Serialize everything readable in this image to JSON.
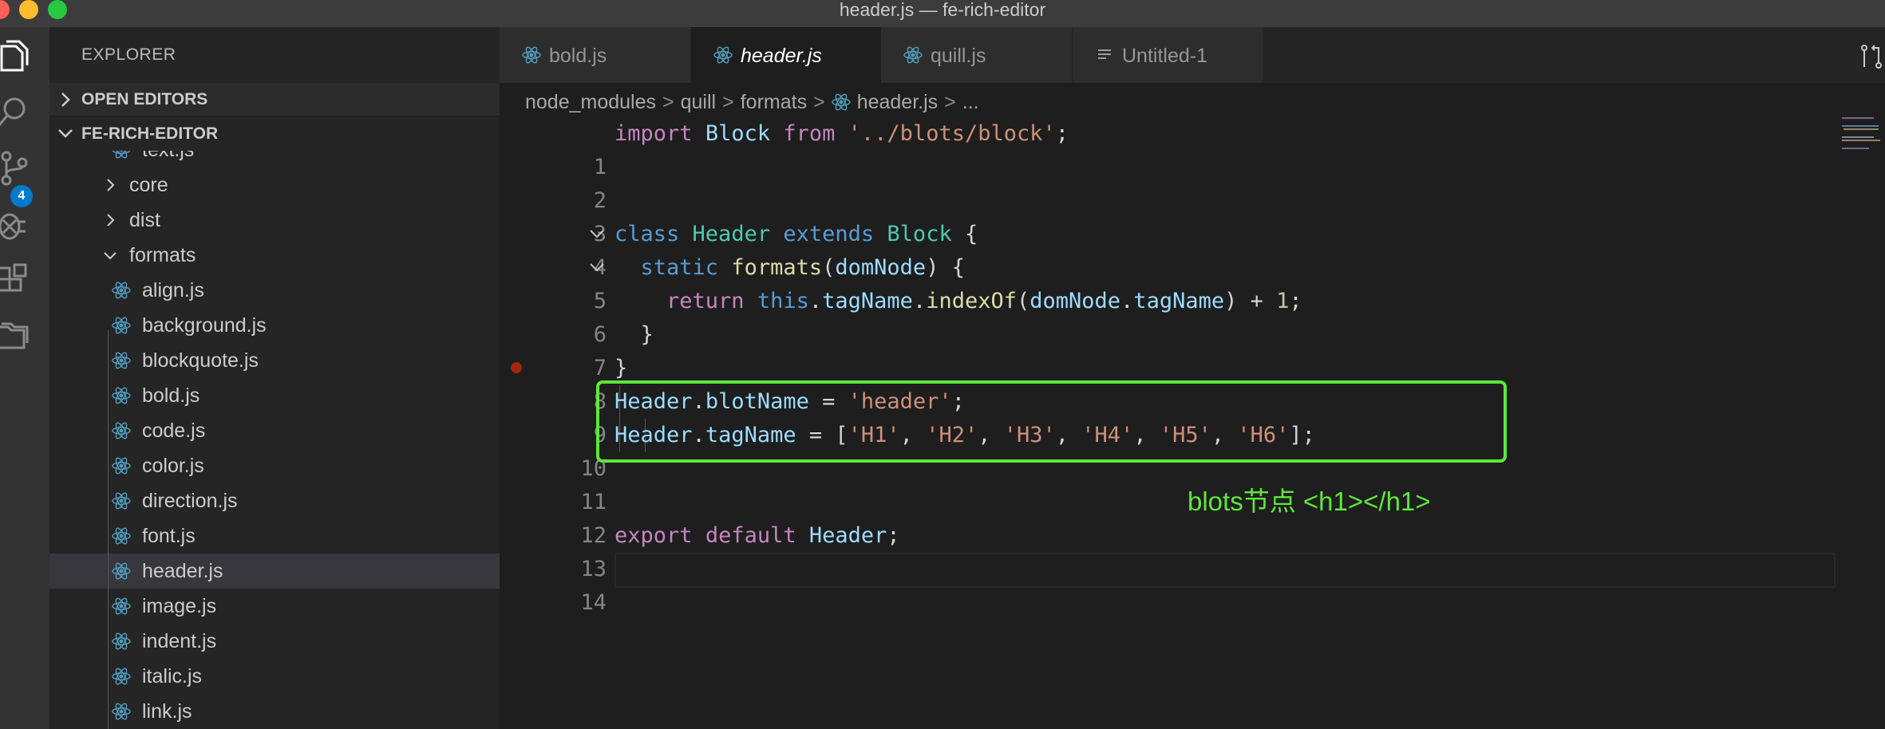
{
  "window": {
    "title": "header.js — fe-rich-editor"
  },
  "activity_bar": {
    "items": [
      {
        "icon": "files-icon"
      },
      {
        "icon": "search-icon"
      },
      {
        "icon": "source-control-icon",
        "badge": "4"
      },
      {
        "icon": "debug-icon"
      },
      {
        "icon": "extensions-icon"
      },
      {
        "icon": "folder-icon"
      }
    ]
  },
  "sidebar": {
    "title": "EXPLORER",
    "open_editors": "OPEN EDITORS",
    "project": "FE-RICH-EDITOR",
    "tree": [
      {
        "name": "text.js",
        "type": "file"
      },
      {
        "name": "core",
        "type": "folder"
      },
      {
        "name": "dist",
        "type": "folder"
      },
      {
        "name": "formats",
        "type": "folder-open"
      },
      {
        "name": "align.js",
        "type": "file"
      },
      {
        "name": "background.js",
        "type": "file"
      },
      {
        "name": "blockquote.js",
        "type": "file"
      },
      {
        "name": "bold.js",
        "type": "file"
      },
      {
        "name": "code.js",
        "type": "file"
      },
      {
        "name": "color.js",
        "type": "file"
      },
      {
        "name": "direction.js",
        "type": "file"
      },
      {
        "name": "font.js",
        "type": "file"
      },
      {
        "name": "header.js",
        "type": "file",
        "selected": true
      },
      {
        "name": "image.js",
        "type": "file"
      },
      {
        "name": "indent.js",
        "type": "file"
      },
      {
        "name": "italic.js",
        "type": "file"
      },
      {
        "name": "link.js",
        "type": "file"
      }
    ]
  },
  "tabs": [
    {
      "label": "bold.js",
      "icon": "react-icon"
    },
    {
      "label": "header.js",
      "icon": "react-icon",
      "active": true
    },
    {
      "label": "quill.js",
      "icon": "react-icon"
    },
    {
      "label": "Untitled-1",
      "icon": "text-file-icon"
    }
  ],
  "breadcrumb": [
    "node_modules",
    "quill",
    "formats",
    "header.js",
    "..."
  ],
  "editor": {
    "line_numbers": [
      "1",
      "2",
      "3",
      "4",
      "5",
      "6",
      "7",
      "8",
      "9",
      "10",
      "11",
      "12",
      "13",
      "14"
    ],
    "lines": [
      "import Block from '../blots/block';",
      "",
      "",
      "class Header extends Block {",
      "  static formats(domNode) {",
      "    return this.tagName.indexOf(domNode.tagName) + 1;",
      "  }",
      "}",
      "Header.blotName = 'header';",
      "Header.tagName = ['H1', 'H2', 'H3', 'H4', 'H5', 'H6'];",
      "",
      "",
      "export default Header;",
      ""
    ]
  },
  "annotation": "blots节点 <h1></h1>",
  "colors": {
    "keyword": "#c586c0",
    "storage": "#569cd6",
    "type": "#4ec9b0",
    "variable": "#9cdcfe",
    "function": "#dcdcaa",
    "string": "#ce9178",
    "number": "#b5cea8",
    "annotation": "#5de83a"
  }
}
